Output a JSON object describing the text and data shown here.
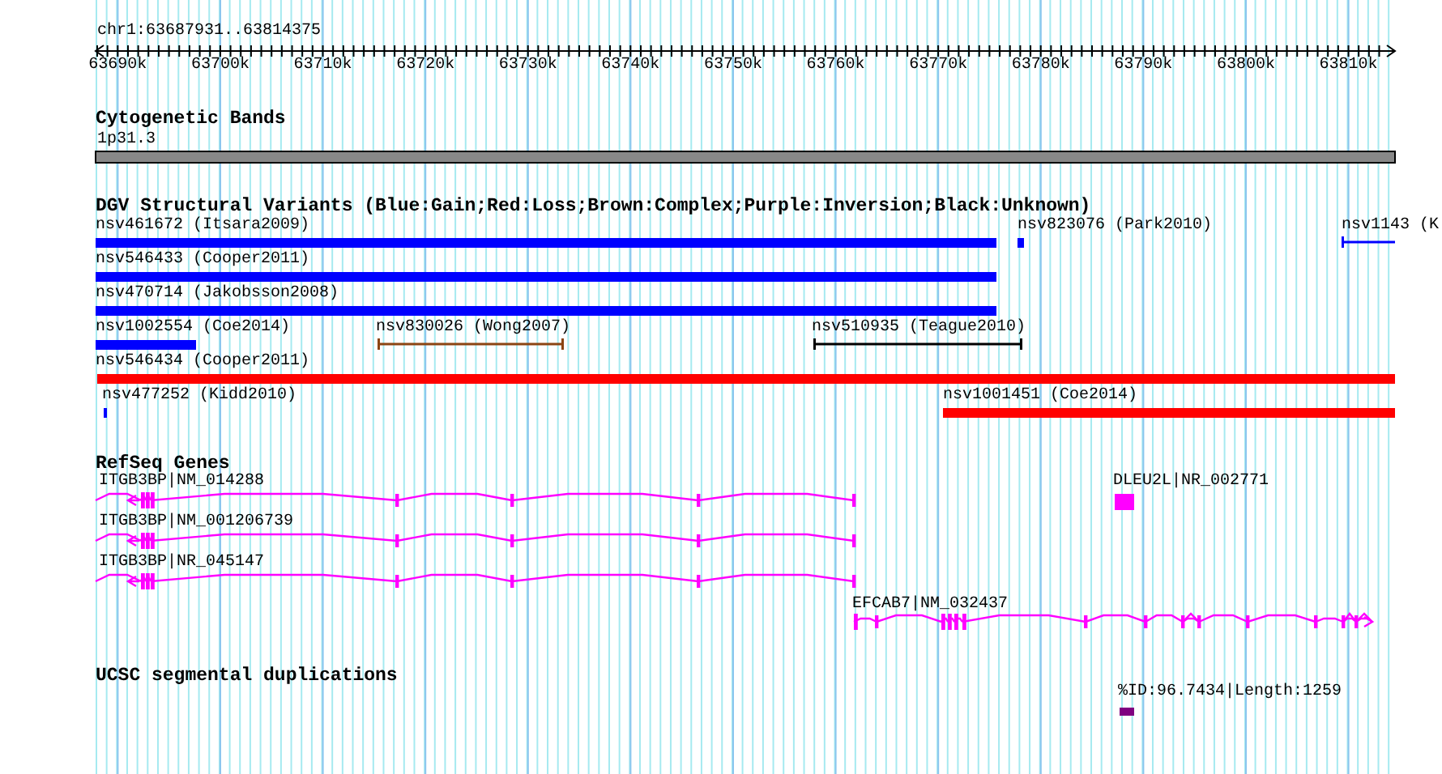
{
  "ruler": {
    "position": "chr1:63687931..63814375",
    "ticks": [
      "63690k",
      "63700k",
      "63710k",
      "63720k",
      "63730k",
      "63740k",
      "63750k",
      "63760k",
      "63770k",
      "63780k",
      "63790k",
      "63800k",
      "63810k"
    ]
  },
  "tracks": [
    {
      "kind": "bands",
      "title": "Cytogenetic Bands",
      "features": [
        {
          "label": "1p31.3"
        }
      ]
    },
    {
      "kind": "variants",
      "title": "DGV Structural Variants (Blue:Gain;Red:Loss;Brown:Complex;Purple:Inversion;Black:Unknown)",
      "features": [
        {
          "label": "nsv461672 (Itsara2009)",
          "kind": "bar",
          "color": "#0000ff"
        },
        {
          "label": "nsv823076 (Park2010)",
          "kind": "bar",
          "color": "#0000ff"
        },
        {
          "label": "nsv1143 (K",
          "kind": "interval",
          "color": "#0000ff"
        },
        {
          "label": "nsv546433 (Cooper2011)",
          "kind": "bar",
          "color": "#0000ff"
        },
        {
          "label": "nsv470714 (Jakobsson2008)",
          "kind": "bar",
          "color": "#0000ff"
        },
        {
          "label": "nsv1002554 (Coe2014)",
          "kind": "bar",
          "color": "#0000ff"
        },
        {
          "label": "nsv830026 (Wong2007)",
          "kind": "interval",
          "color": "#8b4513"
        },
        {
          "label": "nsv510935 (Teague2010)",
          "kind": "interval",
          "color": "#000000"
        },
        {
          "label": "nsv546434 (Cooper2011)",
          "kind": "bar",
          "color": "#ff0000"
        },
        {
          "label": "nsv477252 (Kidd2010)",
          "kind": "bar",
          "color": "#0000ff"
        },
        {
          "label": "nsv1001451 (Coe2014)",
          "kind": "bar",
          "color": "#ff0000"
        }
      ]
    },
    {
      "kind": "genes",
      "title": "RefSeq Genes",
      "features": [
        {
          "label": "ITGB3BP|NM_014288"
        },
        {
          "label": "DLEU2L|NR_002771"
        },
        {
          "label": "ITGB3BP|NM_001206739"
        },
        {
          "label": "ITGB3BP|NR_045147"
        },
        {
          "label": "EFCAB7|NM_032437"
        }
      ]
    },
    {
      "kind": "duplications",
      "title": "UCSC segmental duplications",
      "features": [
        {
          "label": "%ID:96.7434|Length:1259",
          "color": "#800080"
        }
      ]
    }
  ]
}
